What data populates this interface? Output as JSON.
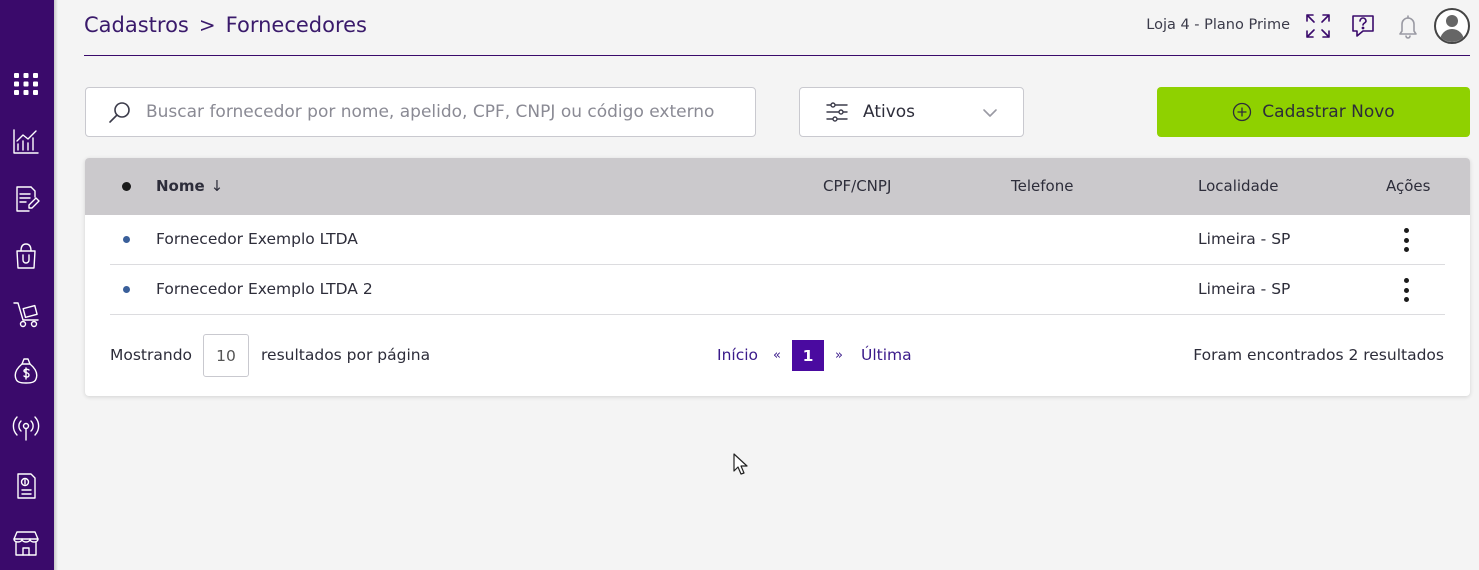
{
  "sidebar": {
    "items": [
      {
        "icon": "apps-grid-icon"
      },
      {
        "icon": "chart-icon"
      },
      {
        "icon": "document-edit-icon"
      },
      {
        "icon": "shopping-bag-icon"
      },
      {
        "icon": "hand-truck-icon"
      },
      {
        "icon": "money-bag-icon"
      },
      {
        "icon": "antenna-icon"
      },
      {
        "icon": "receipt-icon"
      },
      {
        "icon": "store-icon"
      }
    ]
  },
  "header": {
    "breadcrumb": [
      "Cadastros",
      "Fornecedores"
    ],
    "breadcrumb_separator": ">",
    "store_label": "Loja 4 - Plano Prime"
  },
  "toolbar": {
    "search_placeholder": "Buscar fornecedor por nome, apelido, CPF, CNPJ ou código externo",
    "filter_value": "Ativos",
    "new_button_label": "Cadastrar Novo"
  },
  "table": {
    "columns": {
      "name": "Nome",
      "sort_arrow": "↓",
      "document": "CPF/CNPJ",
      "phone": "Telefone",
      "location": "Localidade",
      "actions": "Ações"
    },
    "rows": [
      {
        "name": "Fornecedor Exemplo LTDA",
        "document": "",
        "phone": "",
        "location": "Limeira - SP"
      },
      {
        "name": "Fornecedor Exemplo LTDA 2",
        "document": "",
        "phone": "",
        "location": "Limeira - SP"
      }
    ]
  },
  "pagination": {
    "showing_label": "Mostrando",
    "per_page_value": "10",
    "per_page_suffix": "resultados por página",
    "first_label": "Início",
    "prev_label": "«",
    "current_page": "1",
    "next_label": "»",
    "last_label": "Última",
    "results_text": "Foram encontrados 2 resultados"
  },
  "colors": {
    "sidebar": "#3a0a6b",
    "accent_green": "#8fd100",
    "active_page": "#4a0aa0",
    "row_dot": "#3a5f9a"
  }
}
